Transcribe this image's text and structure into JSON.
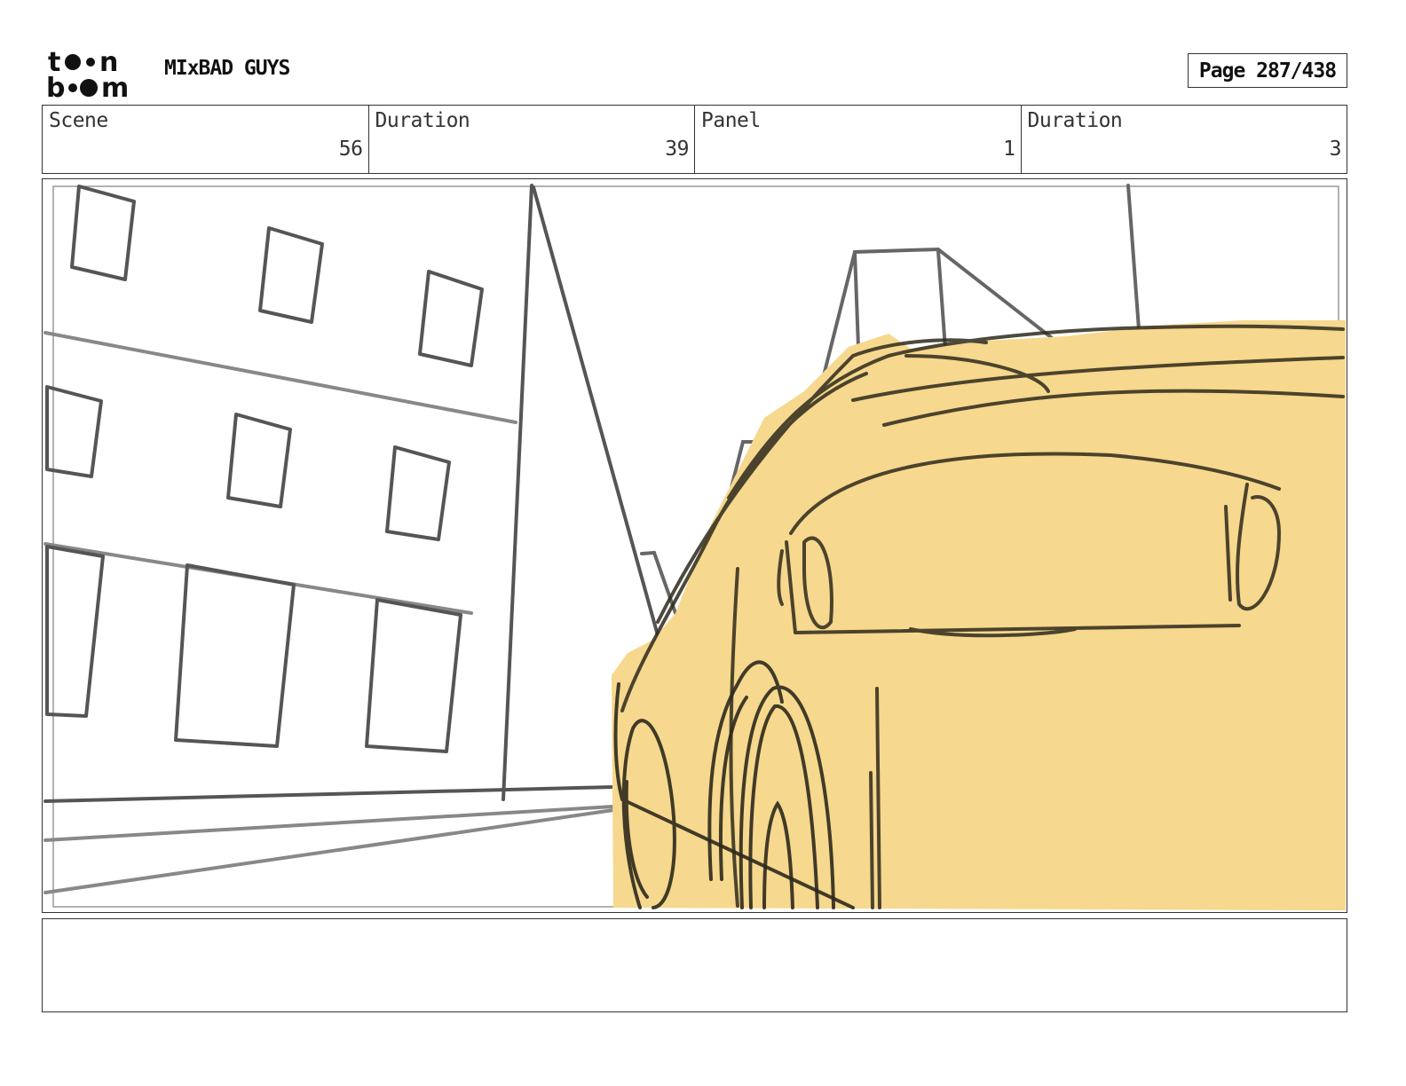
{
  "header": {
    "logo_text_top": "toon",
    "logo_text_bottom": "boom",
    "project_title": "MIxBAD GUYS",
    "page_label": "Page 287/438"
  },
  "info": {
    "scene_label": "Scene",
    "scene_value": "56",
    "scene_duration_label": "Duration",
    "scene_duration_value": "39",
    "panel_label": "Panel",
    "panel_value": "1",
    "panel_duration_label": "Duration",
    "panel_duration_value": "3"
  },
  "notes": {
    "text": ""
  },
  "colors": {
    "car_fill": "#f6d88e",
    "sketch_dark": "#2e2a1c",
    "sketch_grey": "#666666"
  }
}
